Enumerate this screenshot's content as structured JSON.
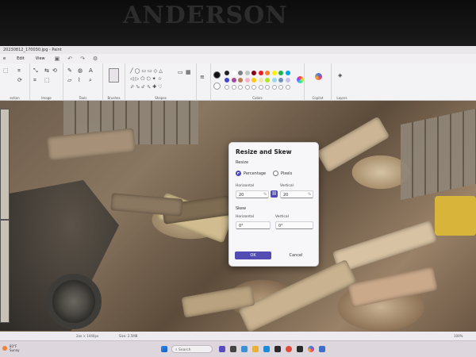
{
  "monitor": {
    "brand": "ANDERSON"
  },
  "window": {
    "title": "20230812_170030.jpg - Paint"
  },
  "menu": {
    "items": [
      "e",
      "Edit",
      "View"
    ]
  },
  "ribbon": {
    "groups": [
      "ection",
      "Image",
      "Tools",
      "Brushes",
      "Shapes",
      "Colors",
      "Copilot",
      "Layers"
    ]
  },
  "palette": [
    "#222222",
    "#ffffff",
    "#7f7f7f",
    "#c3c3c3",
    "#880015",
    "#ed1c24",
    "#ff7f27",
    "#fff200",
    "#22b14c",
    "#00a2e8",
    "#3f48cc",
    "#a349a4",
    "#b97a57",
    "#ffaec9",
    "#ffc90e",
    "#efe4b0",
    "#b5e61d",
    "#99d9ea",
    "#7092be",
    "#c8bfe7"
  ],
  "dialog": {
    "title": "Resize and Skew",
    "resize_label": "Resize",
    "option_percentage": "Percentage",
    "option_pixels": "Pixels",
    "horizontal_label": "Horizontal",
    "vertical_label": "Vertical",
    "horizontal_value": "20",
    "vertical_value": "20",
    "skew_label": "Skew",
    "skew_horizontal_label": "Horizontal",
    "skew_vertical_label": "Vertical",
    "skew_horizontal_value": "0°",
    "skew_vertical_value": "0°",
    "ok_label": "OK",
    "cancel_label": "Cancel"
  },
  "status": {
    "dims": "2ax × 1440px",
    "size": "Size: 2.5MB",
    "zoom": "100%"
  },
  "taskbar": {
    "weather_temp": "83°F",
    "weather_desc": "Sunny",
    "search_placeholder": "Search"
  }
}
